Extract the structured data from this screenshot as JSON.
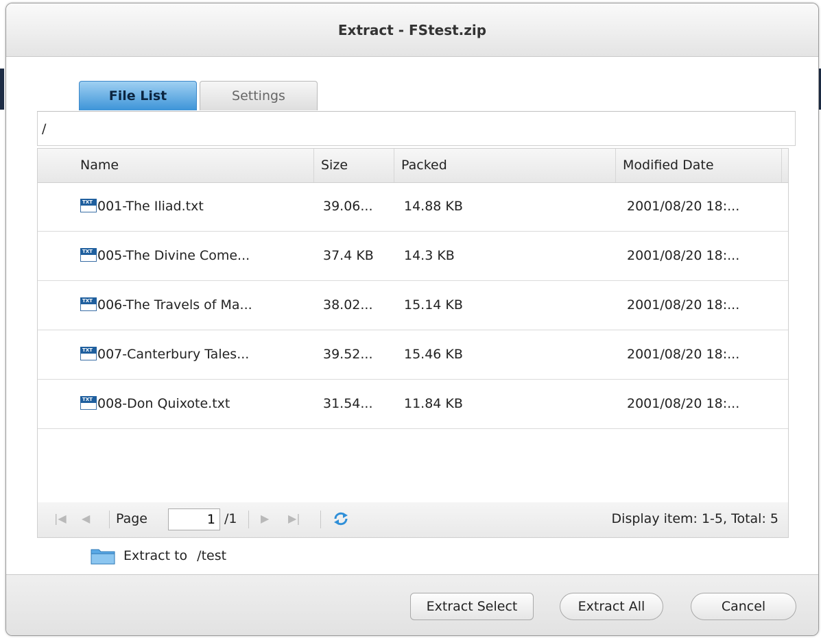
{
  "dialog": {
    "title": "Extract - FStest.zip"
  },
  "tabs": [
    {
      "label": "File List"
    },
    {
      "label": "Settings"
    }
  ],
  "path": "/",
  "columns": {
    "name": "Name",
    "size": "Size",
    "packed": "Packed",
    "modified": "Modified Date"
  },
  "rows": [
    {
      "name": "001-The Iliad.txt",
      "size": "39.06...",
      "packed": "14.88 KB",
      "modified": "2001/08/20 18:..."
    },
    {
      "name": "005-The Divine Come...",
      "size": "37.4 KB",
      "packed": "14.3 KB",
      "modified": "2001/08/20 18:..."
    },
    {
      "name": "006-The Travels of Ma...",
      "size": "38.02...",
      "packed": "15.14 KB",
      "modified": "2001/08/20 18:..."
    },
    {
      "name": "007-Canterbury Tales...",
      "size": "39.52...",
      "packed": "15.46 KB",
      "modified": "2001/08/20 18:..."
    },
    {
      "name": "008-Don Quixote.txt",
      "size": "31.54...",
      "packed": "11.84 KB",
      "modified": "2001/08/20 18:..."
    }
  ],
  "pager": {
    "page_label": "Page",
    "page_value": "1",
    "page_total": "/1",
    "display_info": "Display item: 1-5, Total: 5"
  },
  "extract_to": {
    "label": "Extract to",
    "path": "/test"
  },
  "buttons": {
    "extract_select": "Extract Select",
    "extract_all": "Extract All",
    "cancel": "Cancel"
  },
  "colors": {
    "tab_active": "#3d94d8",
    "icon_blue": "#1f5f9e",
    "folder": "#5aa9e6"
  },
  "icons": {
    "file": "txt-file-icon",
    "folder": "folder-icon",
    "refresh": "refresh-icon"
  }
}
